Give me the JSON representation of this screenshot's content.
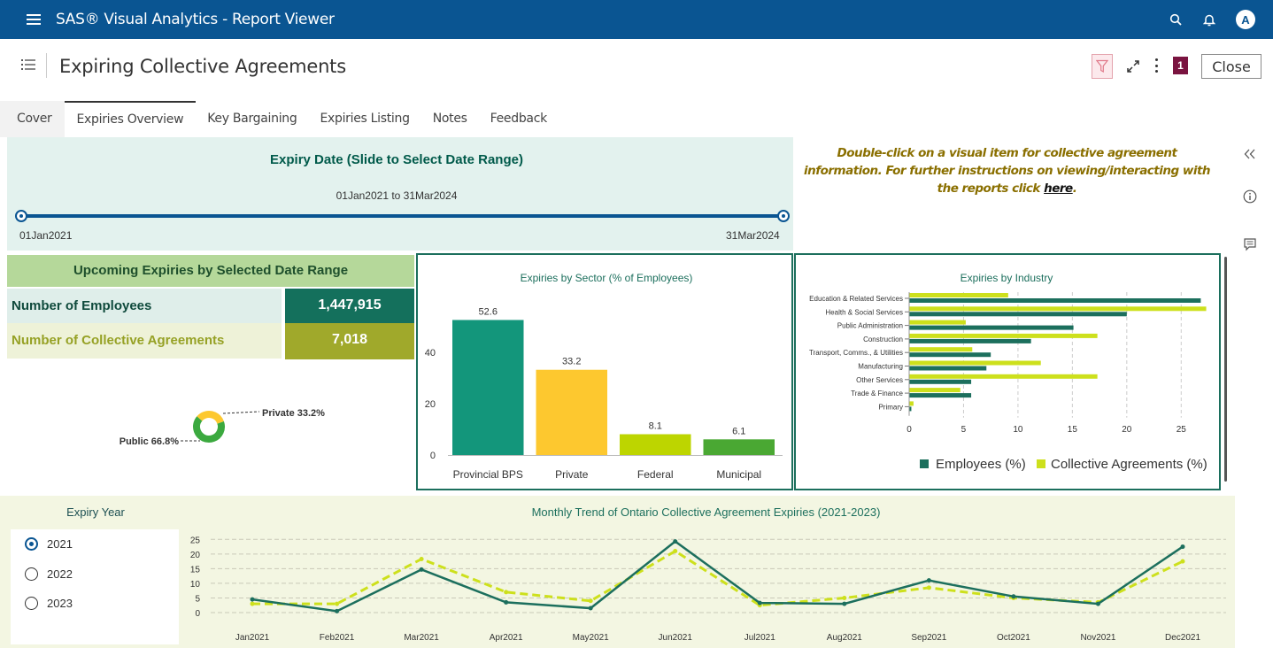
{
  "app": {
    "title": "SAS® Visual Analytics - Report Viewer",
    "avatar_letter": "A"
  },
  "report": {
    "title": "Expiring Collective Agreements",
    "page_badge": "1",
    "close_label": "Close"
  },
  "tabs": [
    "Cover",
    "Expiries Overview",
    "Key Bargaining",
    "Expiries Listing",
    "Notes",
    "Feedback"
  ],
  "active_tab": "Expiries Overview",
  "slider": {
    "title": "Expiry Date (Slide to Select Date Range)",
    "range_text": "01Jan2021 to 31Mar2024",
    "min_label": "01Jan2021",
    "max_label": "31Mar2024",
    "start_fraction": 0.0,
    "end_fraction": 1.0
  },
  "info": {
    "text": "Double-click on a visual item for collective agreement information. For further instructions on viewing/interacting with the reports click ",
    "link": "here",
    "suffix": "."
  },
  "upcoming": {
    "title": "Upcoming Expiries by Selected Date Range",
    "employees_label": "Number of Employees",
    "employees_value": "1,447,915",
    "agreements_label": "Number of Collective Agreements",
    "agreements_value": "7,018"
  },
  "colors": {
    "blue": "#0a5592",
    "teal": "#13967b",
    "gold": "#fdc82f",
    "lime": "#bdd500",
    "green": "#3ba93f",
    "dark_green": "#1c6f5d",
    "chart_lime": "#cde01c",
    "kpi_dark": "#14705c",
    "kpi_olive": "#a0a92b"
  },
  "chart_data": [
    {
      "type": "pie",
      "title": "",
      "slices": [
        {
          "label": "Public 66.8%",
          "name": "Public",
          "value": 66.8
        },
        {
          "label": "Private 33.2%",
          "name": "Private",
          "value": 33.2
        }
      ]
    },
    {
      "type": "bar",
      "title": "Expiries by Sector (% of Employees)",
      "categories": [
        "Provincial BPS",
        "Private",
        "Federal",
        "Municipal"
      ],
      "values": [
        52.6,
        33.2,
        8.1,
        6.1
      ],
      "value_labels": [
        "52.6",
        "33.2",
        "8.1",
        "6.1"
      ],
      "yticks": [
        0,
        20,
        40
      ],
      "ylim": [
        0,
        60
      ]
    },
    {
      "type": "bar",
      "orientation": "horizontal",
      "title": "Expiries by Industry",
      "categories": [
        "Education & Related Services",
        "Health & Social Services",
        "Public Administration",
        "Construction",
        "Transport, Comms., & Utilities",
        "Manufacturing",
        "Other Services",
        "Trade & Finance",
        "Primary"
      ],
      "series": [
        {
          "name": "Employees (%)",
          "values": [
            26.8,
            20.0,
            15.1,
            11.2,
            7.5,
            7.1,
            5.7,
            5.7,
            0.2
          ]
        },
        {
          "name": "Collective Agreements (%)",
          "values": [
            9.1,
            27.3,
            5.2,
            17.3,
            5.8,
            12.1,
            17.3,
            4.7,
            0.4
          ]
        }
      ],
      "xticks": [
        0,
        5,
        10,
        15,
        20,
        25
      ],
      "xlim": [
        0,
        27.5
      ]
    },
    {
      "type": "line",
      "title": "Monthly Trend of Ontario Collective Agreement Expiries (2021-2023)",
      "categories": [
        "Jan2021",
        "Feb2021",
        "Mar2021",
        "Apr2021",
        "May2021",
        "Jun2021",
        "Jul2021",
        "Aug2021",
        "Sep2021",
        "Oct2021",
        "Nov2021",
        "Dec2021"
      ],
      "series": [
        {
          "name": "Employees (%)",
          "values": [
            4.5,
            0.5,
            14.7,
            3.5,
            1.5,
            24.3,
            3.3,
            3.0,
            11.0,
            5.5,
            3.0,
            22.5
          ]
        },
        {
          "name": "Collective Agreements (%)",
          "values": [
            3.0,
            3.0,
            18.3,
            7.0,
            4.0,
            21.0,
            2.5,
            5.0,
            8.5,
            5.0,
            3.5,
            17.5
          ]
        }
      ],
      "yticks": [
        0,
        5,
        10,
        15,
        20,
        25
      ],
      "ylim": [
        0,
        26
      ]
    }
  ],
  "expiry_year": {
    "title": "Expiry Year",
    "options": [
      "2021",
      "2022",
      "2023"
    ],
    "selected": "2021"
  }
}
